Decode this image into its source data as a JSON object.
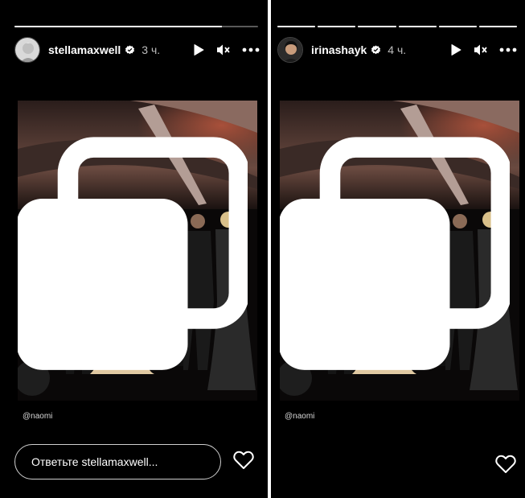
{
  "left_story": {
    "username": "stellamaxwell",
    "time": "3 ч.",
    "progress": [
      0.85
    ],
    "mention": "@naomi",
    "reply_placeholder": "Ответьте stellamaxwell..."
  },
  "right_story": {
    "username": "irinashayk",
    "time": "4 ч.",
    "progress": [
      1,
      1,
      1,
      1,
      1,
      1
    ],
    "mention": "@naomi"
  },
  "icons": {
    "play": "play-icon",
    "mute": "mute-icon",
    "more": "more-icon",
    "verified": "verified-badge-icon",
    "multi": "carousel-icon",
    "like": "heart-icon"
  },
  "colors": {
    "background": "#000000",
    "verified": "#ffffff",
    "muted_text": "#bdbdbd"
  }
}
